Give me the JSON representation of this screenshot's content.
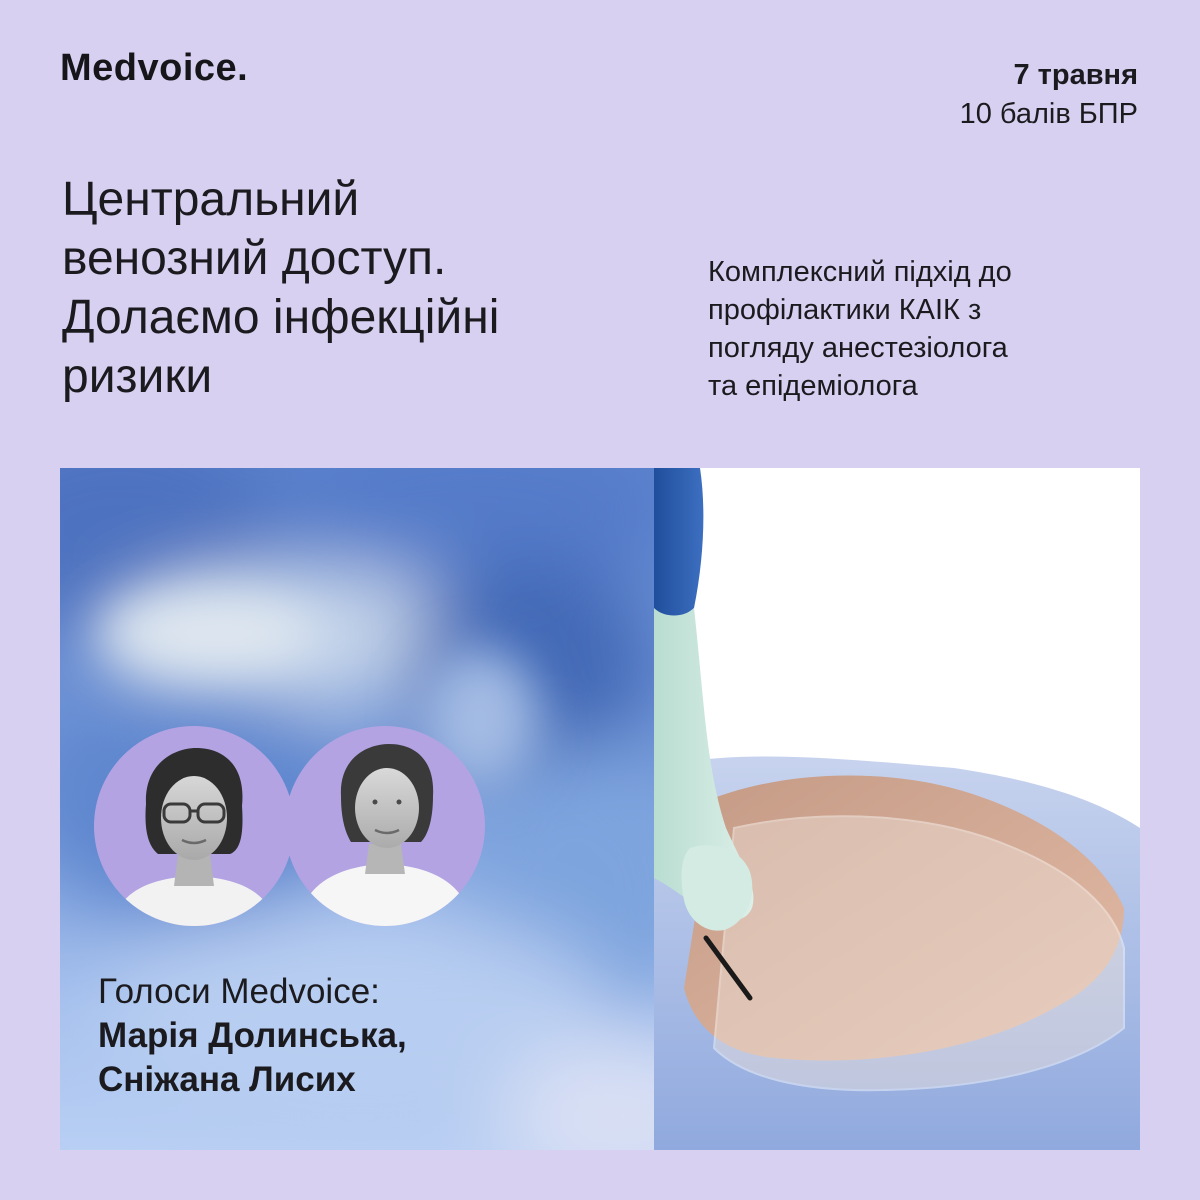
{
  "brand": {
    "name": "Medvoice",
    "dot": "."
  },
  "event": {
    "date": "7 травня",
    "points": "10 балів БПР"
  },
  "headline": {
    "lines": [
      "Центральний",
      "венозний доступ.",
      "Долаємо інфекційні",
      "ризики"
    ]
  },
  "subheadline": {
    "lines": [
      "Комплексний підхід до",
      "профілактики КАІК з",
      "погляду анестезіолога",
      "та епідеміолога"
    ]
  },
  "speakers": {
    "label": "Голоси Medvoice:",
    "names": [
      "Марія Долинська,",
      "Сніжана Лисих"
    ]
  },
  "colors": {
    "background": "#d8d0f1",
    "accent_circle": "#b3a3e3",
    "text": "#1b1b1f",
    "photo_blue": "#6f93d6",
    "glove": "#c9e6dd",
    "drape": "#a9bde6"
  }
}
